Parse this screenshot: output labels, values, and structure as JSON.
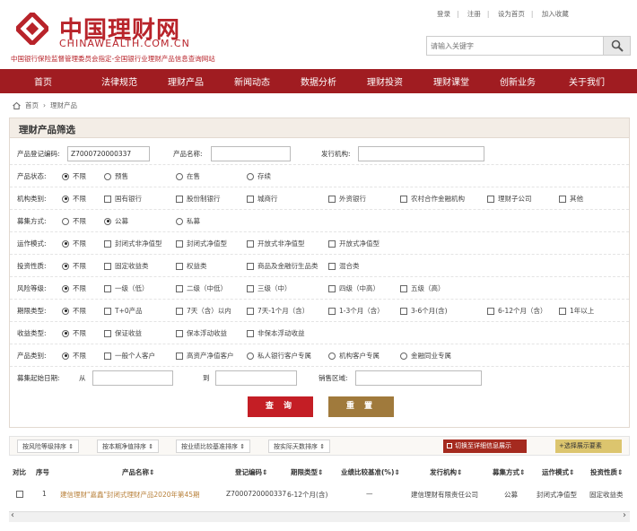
{
  "header": {
    "logo_cn": "中国理财网",
    "logo_en": "CHINAWEALTH.COM.CN",
    "tagline": "中国银行保险监督管理委员会指定-全国银行业理财产品信息查询网站",
    "toplinks": [
      "登录",
      "注册",
      "设为首页",
      "加入收藏"
    ],
    "search_placeholder": "请输入关键字",
    "brand_color": "#b8232a"
  },
  "nav": {
    "items": [
      "首页",
      "法律规范",
      "理财产品",
      "新闻动态",
      "数据分析",
      "理财投资",
      "理财课堂",
      "创新业务",
      "关于我们"
    ],
    "bg_color": "#a01c21"
  },
  "breadcrumb": {
    "home": "首页",
    "sep": "›",
    "current": "理财产品"
  },
  "filter": {
    "title": "理财产品筛选",
    "reg_code_label": "产品登记编码:",
    "reg_code_value": "Z7000720000337",
    "product_name_label": "产品名称:",
    "product_name_value": "",
    "issuer_label": "发行机构:",
    "issuer_value": "",
    "status": {
      "label": "产品状态:",
      "options": [
        "不限",
        "预售",
        "在售",
        "存续"
      ],
      "selected": "不限"
    },
    "institution": {
      "label": "机构类别:",
      "options": [
        "不限",
        "国有银行",
        "股份制银行",
        "城商行",
        "外资银行",
        "农村合作金融机构",
        "理财子公司",
        "其他"
      ],
      "selected": "不限"
    },
    "raise_method": {
      "label": "募集方式:",
      "options": [
        "不限",
        "公募",
        "私募"
      ],
      "selected": "公募"
    },
    "operation_mode": {
      "label": "运作模式:",
      "options": [
        "不限",
        "封闭式非净值型",
        "封闭式净值型",
        "开放式非净值型",
        "开放式净值型"
      ],
      "selected": "不限"
    },
    "invest_type": {
      "label": "投资性质:",
      "options": [
        "不限",
        "固定收益类",
        "权益类",
        "商品及金融衍生品类",
        "混合类"
      ],
      "selected": "不限"
    },
    "risk_level": {
      "label": "风险等级:",
      "options": [
        "不限",
        "一级（低）",
        "二级（中低）",
        "三级（中）",
        "四级（中高）",
        "五级（高）"
      ],
      "selected": "不限"
    },
    "term_type": {
      "label": "期限类型:",
      "options": [
        "不限",
        "T+0产品",
        "7天（含）以内",
        "7天-1个月（含）",
        "1-3个月（含）",
        "3-6个月(含)",
        "6-12个月（含）",
        "1年以上"
      ],
      "selected": "不限"
    },
    "income_type": {
      "label": "收益类型:",
      "options": [
        "不限",
        "保证收益",
        "保本浮动收益",
        "非保本浮动收益"
      ],
      "selected": "不限"
    },
    "product_category": {
      "label": "产品类别:",
      "options": [
        "不限",
        "一般个人客户",
        "高资产净值客户",
        "私人银行客户专属",
        "机构客户专属",
        "金融同业专属"
      ],
      "selected": "不限"
    },
    "raise_start_label": "募集起始日期:",
    "from_label": "从",
    "to_label": "到",
    "sales_region_label": "销售区域:",
    "query_label": "查 询",
    "reset_label": "重 置"
  },
  "sortbar": {
    "buttons": [
      "按风险等级排序 ⇕",
      "按本期净值排序 ⇕",
      "按业绩比较基准排序 ⇕",
      "按实际天数排序 ⇕"
    ],
    "switch_label": "切换至详细信息展示",
    "select_label": "+选择展示要素"
  },
  "table": {
    "headers": [
      "对比",
      "序号",
      "产品名称⇕",
      "登记编码⇕",
      "期限类型⇕",
      "业绩比较基准(%)⇕",
      "发行机构⇕",
      "募集方式⇕",
      "运作模式⇕",
      "投资性质⇕"
    ],
    "rows": [
      {
        "no": "1",
        "name": "建信理财\"嘉鑫\"封闭式理财产品2020年第45期",
        "code": "Z7000720000337",
        "term": "6-12个月(含)",
        "benchmark": "—",
        "issuer": "建信理财有限责任公司",
        "raise": "公募",
        "mode": "封闭式净值型",
        "invest": "固定收益类"
      }
    ]
  }
}
